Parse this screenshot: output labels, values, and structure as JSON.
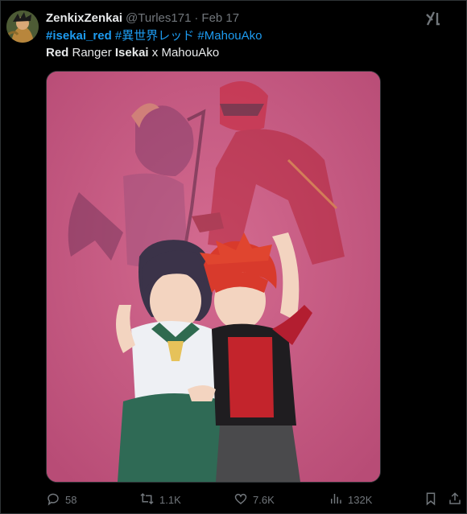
{
  "post": {
    "display_name": "ZenkixZenkai",
    "handle": "@Turles171",
    "separator": "·",
    "date": "Feb 17",
    "hashtags": [
      "#isekai_red",
      "#異世界レッド",
      "#MahouAko"
    ],
    "text_parts": [
      {
        "text": "Red",
        "bold": true
      },
      {
        "text": " Ranger ",
        "bold": false
      },
      {
        "text": "Isekai",
        "bold": true
      },
      {
        "text": " x MahouAko",
        "bold": false
      }
    ]
  },
  "actions": {
    "replies": "58",
    "reposts": "1.1K",
    "likes": "7.6K",
    "views": "132K"
  },
  "colors": {
    "link": "#1d9bf0",
    "muted": "#71767b",
    "text": "#e7e9ea",
    "media_bg": "#c95a82"
  },
  "icons": [
    "grok-icon",
    "reply-icon",
    "repost-icon",
    "like-icon",
    "views-icon",
    "bookmark-icon",
    "share-icon"
  ]
}
